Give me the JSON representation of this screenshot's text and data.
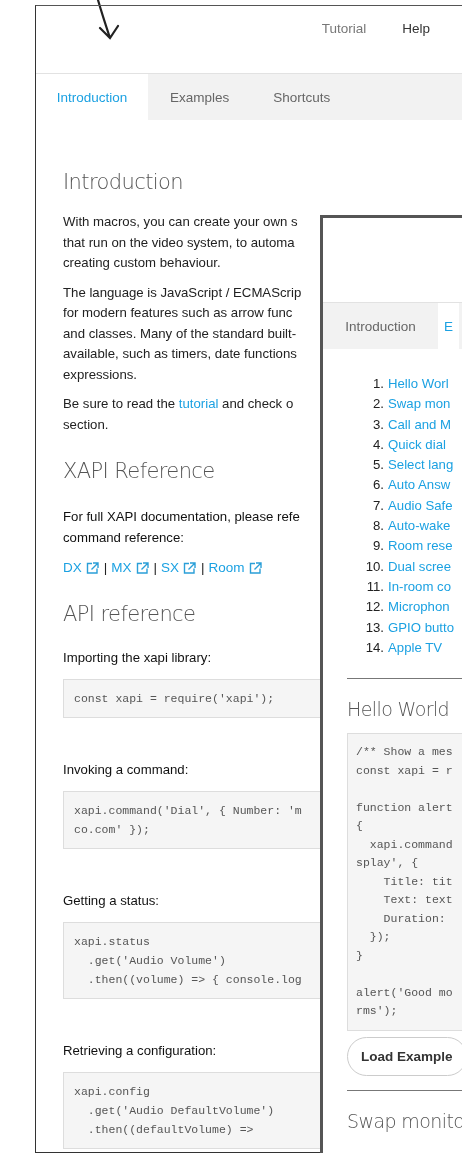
{
  "back_page": {
    "nav": [
      {
        "label": "Tutorial",
        "selected": false
      },
      {
        "label": "Help",
        "selected": true
      }
    ],
    "tabs": [
      {
        "label": "Introduction",
        "selected": true
      },
      {
        "label": "Examples",
        "selected": false
      },
      {
        "label": "Shortcuts",
        "selected": false
      }
    ],
    "intro_heading": "Introduction",
    "paragraphs": [
      {
        "lines": [
          [
            {
              "kind": "text",
              "text": "With macros, you can create your own s"
            }
          ],
          [
            {
              "kind": "text",
              "text": "that run on the video system, to automa"
            }
          ],
          [
            {
              "kind": "text",
              "text": "creating custom behaviour."
            }
          ]
        ]
      },
      {
        "lines": [
          [
            {
              "kind": "text",
              "text": "The language is JavaScript / ECMAScrip"
            }
          ],
          [
            {
              "kind": "text",
              "text": "for modern features such as arrow func"
            }
          ],
          [
            {
              "kind": "text",
              "text": "and classes. Many of the standard built-"
            }
          ],
          [
            {
              "kind": "text",
              "text": "available, such as timers, date functions"
            }
          ],
          [
            {
              "kind": "text",
              "text": "expressions."
            }
          ]
        ]
      },
      {
        "lines": [
          [
            {
              "kind": "text",
              "text": "Be sure to read the "
            },
            {
              "kind": "link",
              "text": "tutorial"
            },
            {
              "kind": "text",
              "text": " and check o"
            }
          ],
          [
            {
              "kind": "text",
              "text": "section."
            }
          ]
        ]
      }
    ],
    "xapi_heading": "XAPI Reference",
    "xapi_text": [
      "For full XAPI documentation, please refe",
      "command reference:"
    ],
    "xapi_links": [
      {
        "label": "DX"
      },
      {
        "label": "MX"
      },
      {
        "label": "SX"
      },
      {
        "label": "Room"
      }
    ],
    "link_separator": "|",
    "api_heading": "API reference",
    "snippets": [
      {
        "label": "Importing the xapi library:",
        "code": [
          "const xapi = require('xapi');"
        ]
      },
      {
        "label": "Invoking a command:",
        "code": [
          "xapi.command('Dial', { Number: 'm",
          "co.com' });"
        ]
      },
      {
        "label": "Getting a status:",
        "code": [
          "xapi.status",
          "  .get('Audio Volume')",
          "  .then((volume) => { console.log"
        ]
      },
      {
        "label": "Retrieving a configuration:",
        "code": [
          "xapi.config",
          "  .get('Audio DefaultVolume')",
          "  .then((defaultVolume) =>"
        ]
      }
    ]
  },
  "front_page": {
    "tabs": [
      {
        "label": "Introduction",
        "selected": false
      },
      {
        "label": "E",
        "selected": true
      }
    ],
    "examples": [
      {
        "number": "1.",
        "title": "Hello Worl"
      },
      {
        "number": "2.",
        "title": "Swap mon"
      },
      {
        "number": "3.",
        "title": "Call and M"
      },
      {
        "number": "4.",
        "title": "Quick dial"
      },
      {
        "number": "5.",
        "title": "Select lang"
      },
      {
        "number": "6.",
        "title": "Auto Answ"
      },
      {
        "number": "7.",
        "title": "Audio Safe"
      },
      {
        "number": "8.",
        "title": "Auto-wake"
      },
      {
        "number": "9.",
        "title": "Room rese"
      },
      {
        "number": "10.",
        "title": "Dual scree"
      },
      {
        "number": "11.",
        "title": "In-room co"
      },
      {
        "number": "12.",
        "title": "Microphon"
      },
      {
        "number": "13.",
        "title": "GPIO butto"
      },
      {
        "number": "14.",
        "title": "Apple TV"
      }
    ],
    "example_heading": "Hello World",
    "code_groups": [
      [
        "/** Show a mes",
        "const xapi = r"
      ],
      [
        "function alert",
        "{",
        "  xapi.command",
        "splay', {",
        "    Title: tit",
        "    Text: text",
        "    Duration:",
        "  });",
        "}"
      ],
      [
        "alert('Good mo",
        "rms');"
      ]
    ],
    "load_button": "Load Example",
    "next_heading": "Swap monito"
  }
}
